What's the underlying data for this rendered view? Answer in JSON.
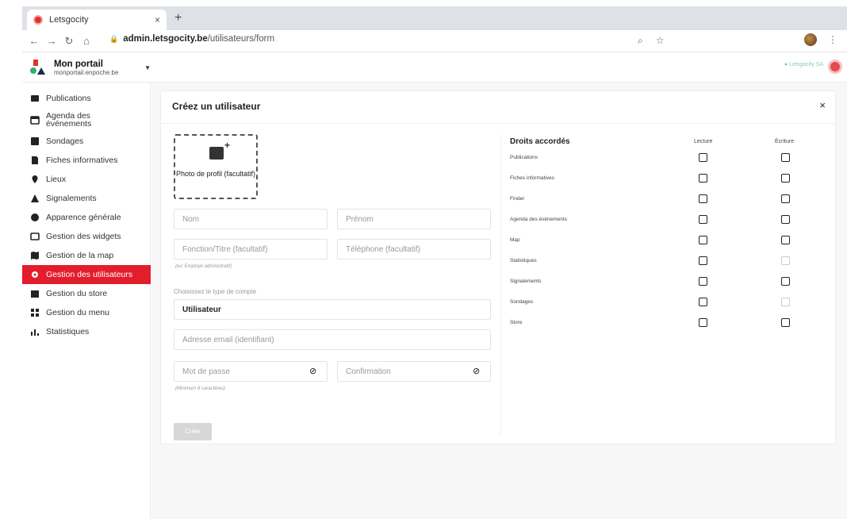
{
  "browser": {
    "tab_title": "Letsgocity",
    "tab_close": "×",
    "new_tab": "+",
    "url_host": "admin.letsgocity.be",
    "url_path": "/utilisateurs/form"
  },
  "header": {
    "portal_title": "Mon portail",
    "portal_subtitle": "monportail.enpoche.be",
    "status_text": "● Letsgocity SA"
  },
  "sidebar": {
    "items": [
      {
        "label": "Publications",
        "icon": "newspaper-icon"
      },
      {
        "label": "Agenda des événements",
        "icon": "calendar-icon"
      },
      {
        "label": "Sondages",
        "icon": "poll-icon"
      },
      {
        "label": "Fiches informatives",
        "icon": "document-icon"
      },
      {
        "label": "Lieux",
        "icon": "location-pin-icon"
      },
      {
        "label": "Signalements",
        "icon": "warning-icon"
      },
      {
        "label": "Apparence générale",
        "icon": "palette-icon"
      },
      {
        "label": "Gestion des widgets",
        "icon": "widget-icon"
      },
      {
        "label": "Gestion de la map",
        "icon": "map-icon"
      },
      {
        "label": "Gestion des utilisateurs",
        "icon": "gear-icon",
        "active": true
      },
      {
        "label": "Gestion du store",
        "icon": "store-icon"
      },
      {
        "label": "Gestion du menu",
        "icon": "grid-icon"
      },
      {
        "label": "Statistiques",
        "icon": "bar-chart-icon"
      }
    ]
  },
  "form": {
    "title": "Créez un utilisateur",
    "close": "×",
    "photo_label": "Photo de profil (facultatif)",
    "nom_placeholder": "Nom",
    "prenom_placeholder": "Prénom",
    "fonction_placeholder": "Fonction/Titre (facultatif)",
    "telephone_placeholder": "Téléphone (facultatif)",
    "fonction_hint": "(ex: Employé administratif)",
    "account_type_label": "Choisissez le type de compte",
    "account_type_value": "Utilisateur",
    "email_placeholder": "Adresse email (identifiant)",
    "password_placeholder": "Mot de passe",
    "confirmation_placeholder": "Confirmation",
    "password_hint": "(Minimum 8 caractères)",
    "submit_label": "Créer"
  },
  "rights": {
    "title": "Droits accordés",
    "col_read": "Lecture",
    "col_write": "Écriture",
    "rows": [
      {
        "label": "Publications",
        "read_disabled": false,
        "write_disabled": false
      },
      {
        "label": "Fiches informatives",
        "read_disabled": false,
        "write_disabled": false
      },
      {
        "label": "Finder",
        "read_disabled": false,
        "write_disabled": false
      },
      {
        "label": "Agenda des événements",
        "read_disabled": false,
        "write_disabled": false
      },
      {
        "label": "Map",
        "read_disabled": false,
        "write_disabled": false
      },
      {
        "label": "Statistiques",
        "read_disabled": false,
        "write_disabled": true
      },
      {
        "label": "Signalements",
        "read_disabled": false,
        "write_disabled": false
      },
      {
        "label": "Sondages",
        "read_disabled": false,
        "write_disabled": true
      },
      {
        "label": "Store",
        "read_disabled": false,
        "write_disabled": false
      }
    ]
  }
}
